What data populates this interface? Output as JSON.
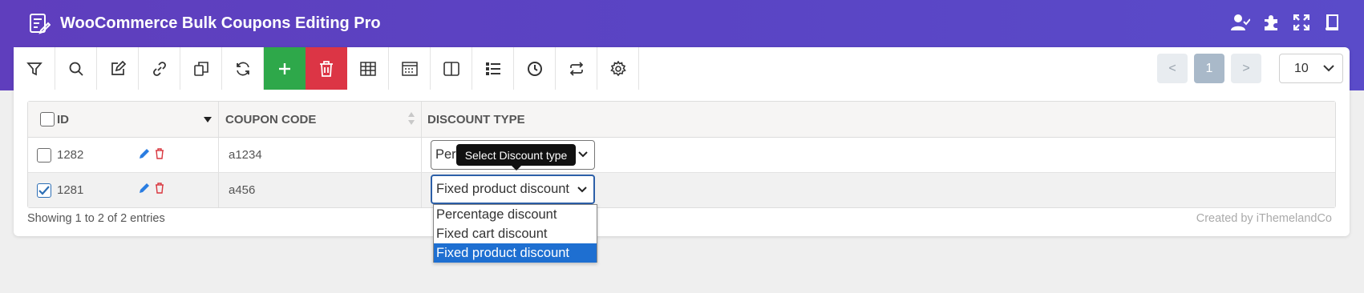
{
  "app": {
    "title": "WooCommerce Bulk Coupons Editing Pro"
  },
  "header_icons": [
    "user-check-icon",
    "puzzle-icon",
    "fullscreen-icon",
    "book-icon"
  ],
  "toolbar": {
    "buttons": [
      "filter-icon",
      "search-icon",
      "edit-icon",
      "link-icon",
      "duplicate-icon",
      "refresh-icon",
      "add-icon",
      "delete-icon",
      "table-icon",
      "column-layout-icon",
      "split-view-icon",
      "list-icon",
      "history-icon",
      "swap-icon",
      "settings-icon"
    ]
  },
  "pagination": {
    "prev": "<",
    "current": "1",
    "next": ">",
    "per_page": "10"
  },
  "table": {
    "columns": {
      "id": "ID",
      "coupon_code": "COUPON CODE",
      "discount_type": "DISCOUNT TYPE"
    },
    "rows": [
      {
        "id": "1282",
        "checked": false,
        "coupon_code": "a1234",
        "discount_type": "Percentage discount",
        "discount_type_visible": "Per"
      },
      {
        "id": "1281",
        "checked": true,
        "coupon_code": "a456",
        "discount_type": "Fixed product discount"
      }
    ]
  },
  "tooltip": "Select Discount type",
  "dropdown": {
    "options": [
      "Percentage discount",
      "Fixed cart discount",
      "Fixed product discount"
    ],
    "selected_index": 2
  },
  "footer": {
    "showing": "Showing 1 to 2 of 2 entries",
    "credit": "Created by iThemelandCo"
  },
  "colors": {
    "header": "#5a44c4",
    "add_button": "#2ea84a",
    "delete_button": "#dc3545",
    "selected_option": "#1e6fd1"
  }
}
